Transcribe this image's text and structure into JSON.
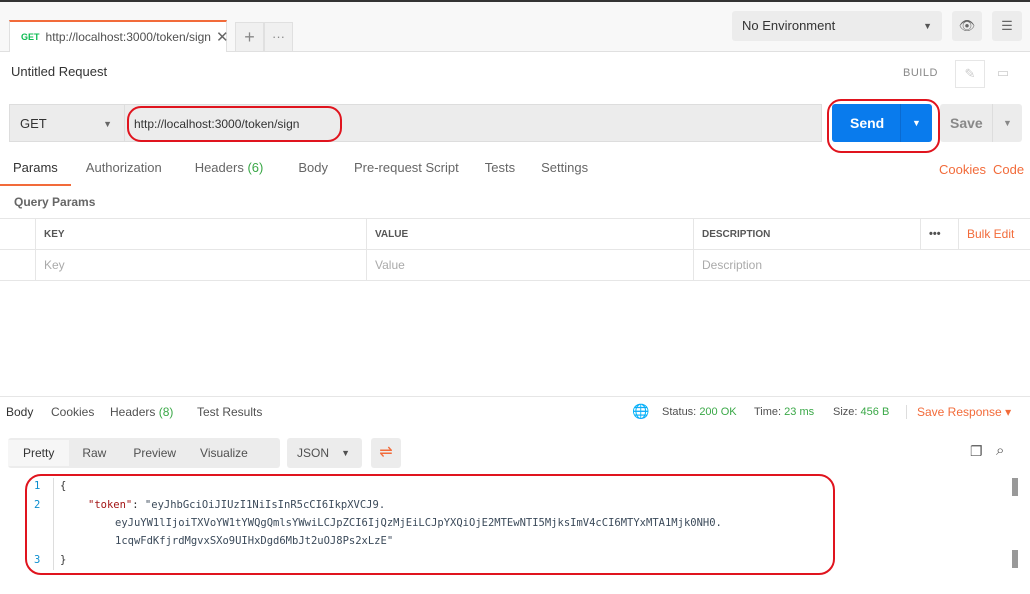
{
  "tab": {
    "method": "GET",
    "url": "http://localhost:3000/token/sign"
  },
  "environment": {
    "selected": "No Environment"
  },
  "request": {
    "title": "Untitled Request",
    "build": "BUILD",
    "method": "GET",
    "url": "http://localhost:3000/token/sign",
    "send": "Send",
    "save": "Save"
  },
  "request_tabs": [
    {
      "label": "Params"
    },
    {
      "label": "Authorization"
    },
    {
      "label": "Headers",
      "count": "(6)"
    },
    {
      "label": "Body"
    },
    {
      "label": "Pre-request Script"
    },
    {
      "label": "Tests"
    },
    {
      "label": "Settings"
    }
  ],
  "links": {
    "cookies": "Cookies",
    "code": "Code"
  },
  "query_params": {
    "title": "Query Params",
    "headers": [
      "KEY",
      "VALUE",
      "DESCRIPTION"
    ],
    "bulk_edit": "Bulk Edit",
    "placeholders": [
      "Key",
      "Value",
      "Description"
    ]
  },
  "response": {
    "tabs": [
      {
        "label": "Body"
      },
      {
        "label": "Cookies"
      },
      {
        "label": "Headers",
        "count": "(8)"
      },
      {
        "label": "Test Results"
      }
    ],
    "status_label": "Status:",
    "status": "200 OK",
    "time_label": "Time:",
    "time": "23 ms",
    "size_label": "Size:",
    "size": "456 B",
    "save": "Save Response",
    "views": [
      "Pretty",
      "Raw",
      "Preview",
      "Visualize"
    ],
    "format": "JSON"
  },
  "body_lines": [
    {
      "n": "1",
      "text": "{"
    },
    {
      "n": "2",
      "key": "\"token\"",
      "sep": ": ",
      "value": "\"eyJhbGciOiJIUzI1NiIsInR5cCI6IkpXVCJ9."
    },
    {
      "value": "eyJuYW1lIjoiTXVoYW1tYWQgQmlsYWwiLCJpZCI6IjQzMjEiLCJpYXQiOjE2MTEwNTI5MjksImV4cCI6MTYxMTA1Mjk0NH0."
    },
    {
      "value": "1cqwFdKfjrdMgvxSXo9UIHxDgd6MbJt2uOJ8Ps2xLzE\""
    },
    {
      "n": "3",
      "text": "}"
    }
  ]
}
